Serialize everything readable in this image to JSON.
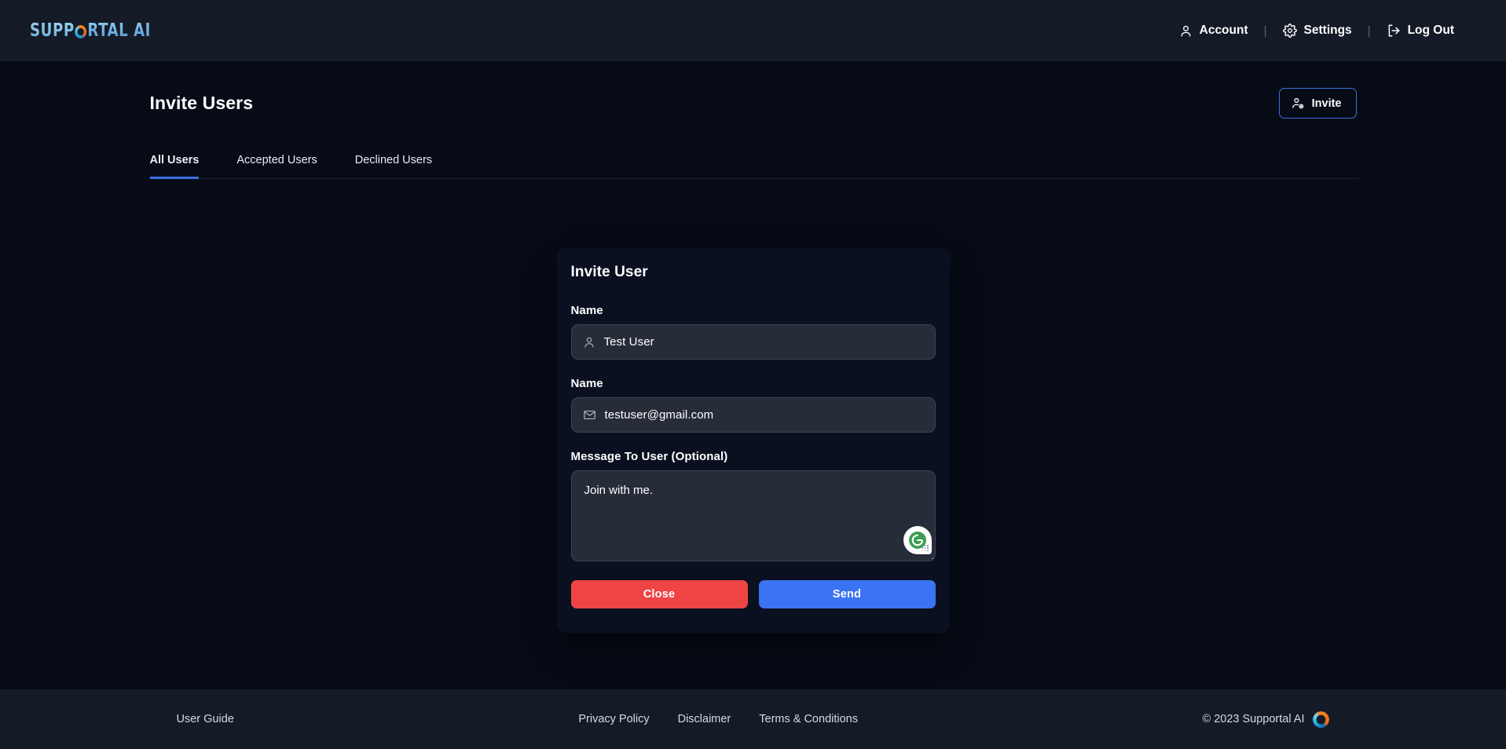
{
  "topbar": {
    "brand": {
      "part1": "SUPP",
      "ring_icon": "ring-logo",
      "part2": "RTAL AI"
    },
    "nav": [
      {
        "icon": "person-icon",
        "label": "Account"
      },
      {
        "icon": "gear-icon",
        "label": "Settings"
      },
      {
        "icon": "logout-icon",
        "label": "Log Out"
      }
    ],
    "separator": "|"
  },
  "page": {
    "title": "Invite Users",
    "invite_button": {
      "label": "Invite",
      "icon": "add-user-icon"
    },
    "tabs": [
      {
        "label": "All Users",
        "active": true
      },
      {
        "label": "Accepted Users",
        "active": false
      },
      {
        "label": "Declined Users",
        "active": false
      }
    ]
  },
  "form": {
    "title": "Invite User",
    "name_label": "Name",
    "name_value": "Test User",
    "name_icon": "person-icon",
    "email_label": "Name",
    "email_value": "testuser@gmail.com",
    "email_icon": "envelope-icon",
    "message_label": "Message To User (Optional)",
    "message_value": "Join with me.",
    "grammarly_icon": "grammarly-icon",
    "close_label": "Close",
    "send_label": "Send"
  },
  "footer": {
    "user_guide": "User Guide",
    "links": [
      {
        "label": "Privacy Policy"
      },
      {
        "label": "Disclaimer"
      },
      {
        "label": "Terms & Conditions"
      }
    ],
    "copyright": "© 2023 Supportal AI",
    "logo_icon": "ring-logo"
  },
  "colors": {
    "accent_blue": "#3b6fe0",
    "send_blue": "#3b74f2",
    "close_red": "#ef4444",
    "bar_bg": "#141a26",
    "page_bg": "#060b16",
    "input_bg": "#272c39",
    "grammarly_green": "#3a9e52"
  }
}
